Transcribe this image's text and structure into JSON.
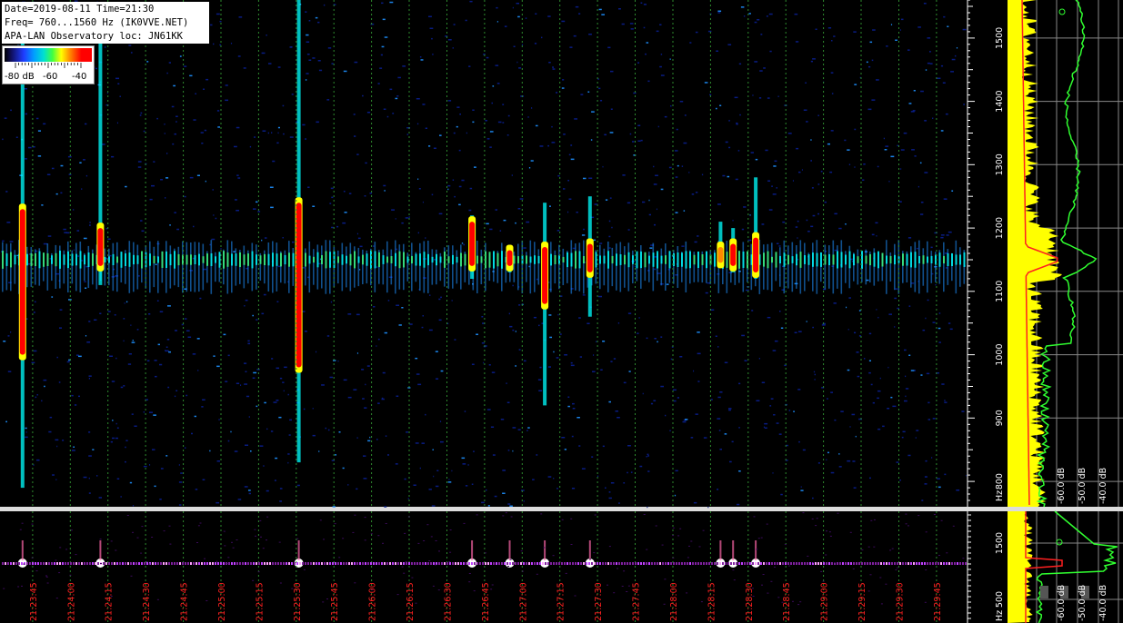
{
  "header": {
    "line1": "Date=2019-08-11 Time=21:30",
    "line2": "Freq= 760...1560 Hz (IK0VVE.NET)",
    "line3": "APA-LAN Observatory loc: JN61KK"
  },
  "colorbar": {
    "label_low": "-80 dB",
    "label_mid": "-60",
    "label_high": "-40"
  },
  "colors": {
    "background": "#000000",
    "noise": "#0a1f8f",
    "weak": "#1e90ff",
    "medium": "#00ffff",
    "strong": "#ffff00",
    "peak": "#ff0000",
    "grid": "#2e8b2e",
    "time_label": "#ff2020",
    "spectrum_fill": "#ffff00",
    "spectrum_avg": "#ff2020",
    "spectrum_green": "#30ff30",
    "axis_text": "#ffffff"
  },
  "chart_data": {
    "type": "heatmap",
    "xlabel": "",
    "ylabel": "Hz",
    "ylim": [
      760,
      1560
    ],
    "y_ticks": [
      800,
      900,
      1000,
      1100,
      1200,
      1300,
      1400,
      1500
    ],
    "baseline_hz": 1150,
    "time_labels": [
      "21:23:45",
      "21:24:00",
      "21:24:15",
      "21:24:30",
      "21:24:45",
      "21:25:00",
      "21:25:15",
      "21:25:30",
      "21:25:45",
      "21:26:00",
      "21:26:15",
      "21:26:30",
      "21:26:45",
      "21:27:00",
      "21:27:15",
      "21:27:30",
      "21:27:45",
      "21:28:00",
      "21:28:15",
      "21:28:30",
      "21:28:45",
      "21:29:00",
      "21:29:15",
      "21:29:30",
      "21:29:45"
    ],
    "x_range_seconds": [
      -13,
      372
    ],
    "echoes": [
      {
        "t": -4,
        "f_low": 790,
        "f_high": 1500,
        "core_low": 1000,
        "core_high": 1230,
        "intensity": "peak"
      },
      {
        "t": 27,
        "f_low": 1110,
        "f_high": 1540,
        "core_low": 1140,
        "core_high": 1200,
        "intensity": "peak"
      },
      {
        "t": 106,
        "f_low": 830,
        "f_high": 1570,
        "core_low": 980,
        "core_high": 1240,
        "intensity": "peak"
      },
      {
        "t": 175,
        "f_low": 1120,
        "f_high": 1220,
        "core_low": 1140,
        "core_high": 1210,
        "intensity": "peak"
      },
      {
        "t": 190,
        "f_low": 1130,
        "f_high": 1170,
        "core_low": 1140,
        "core_high": 1165,
        "intensity": "peak"
      },
      {
        "t": 204,
        "f_low": 920,
        "f_high": 1240,
        "core_low": 1080,
        "core_high": 1170,
        "intensity": "peak"
      },
      {
        "t": 222,
        "f_low": 1060,
        "f_high": 1250,
        "core_low": 1130,
        "core_high": 1175,
        "intensity": "peak"
      },
      {
        "t": 274,
        "f_low": 1140,
        "f_high": 1210,
        "core_low": 1145,
        "core_high": 1170,
        "intensity": "strong"
      },
      {
        "t": 279,
        "f_low": 1130,
        "f_high": 1200,
        "core_low": 1140,
        "core_high": 1175,
        "intensity": "peak"
      },
      {
        "t": 288,
        "f_low": 1120,
        "f_high": 1280,
        "core_low": 1130,
        "core_high": 1185,
        "intensity": "peak"
      }
    ],
    "spectrum": {
      "dB_labels": [
        "-60.0 dB",
        "-50.0 dB",
        "-40.0 dB"
      ],
      "lower_dB_labels": [
        "-60.0 dB",
        "-50.0 dB",
        "-40.0 dB"
      ],
      "lower_y_ticks": [
        500,
        1500
      ],
      "lower_ylabel": "Hz"
    }
  }
}
